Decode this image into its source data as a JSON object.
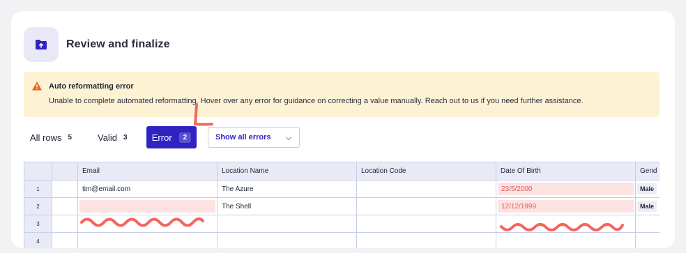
{
  "header": {
    "title": "Review and finalize",
    "icon": "folder-upload-icon"
  },
  "alert": {
    "icon": "warning-icon",
    "title": "Auto reformatting error",
    "message": "Unable to complete automated reformatting. Hover over any error for guidance on correcting a value manually. Reach out to us if you need further assistance.",
    "bg_color": "#fdf3d4",
    "icon_color": "#e8671f"
  },
  "tabs": [
    {
      "label": "All rows",
      "count": "5"
    },
    {
      "label": "Valid",
      "count": "3"
    },
    {
      "label": "Error",
      "count": "2"
    }
  ],
  "filter": {
    "selected": "Show all errors"
  },
  "grid": {
    "columns": [
      "Email",
      "Location Name",
      "Location Code",
      "Date Of Birth",
      "Gend"
    ],
    "rows": [
      {
        "num": "1",
        "email": "tim@email.com",
        "location_name": "The Azure",
        "location_code": "",
        "dob": "23/5/2000",
        "gender": "Male"
      },
      {
        "num": "2",
        "email": "",
        "location_name": "The Shell",
        "location_code": "",
        "dob": "12/12/1999",
        "gender": "Male"
      },
      {
        "num": "3",
        "email": "",
        "location_name": "",
        "location_code": "",
        "dob": "",
        "gender": ""
      },
      {
        "num": "4",
        "email": "",
        "location_name": "",
        "location_code": "",
        "dob": "",
        "gender": ""
      }
    ]
  },
  "colors": {
    "accent": "#2f24c0",
    "error_bg": "#fde2e2",
    "error_text": "#e05a5a",
    "annotation": "#f2665e"
  }
}
